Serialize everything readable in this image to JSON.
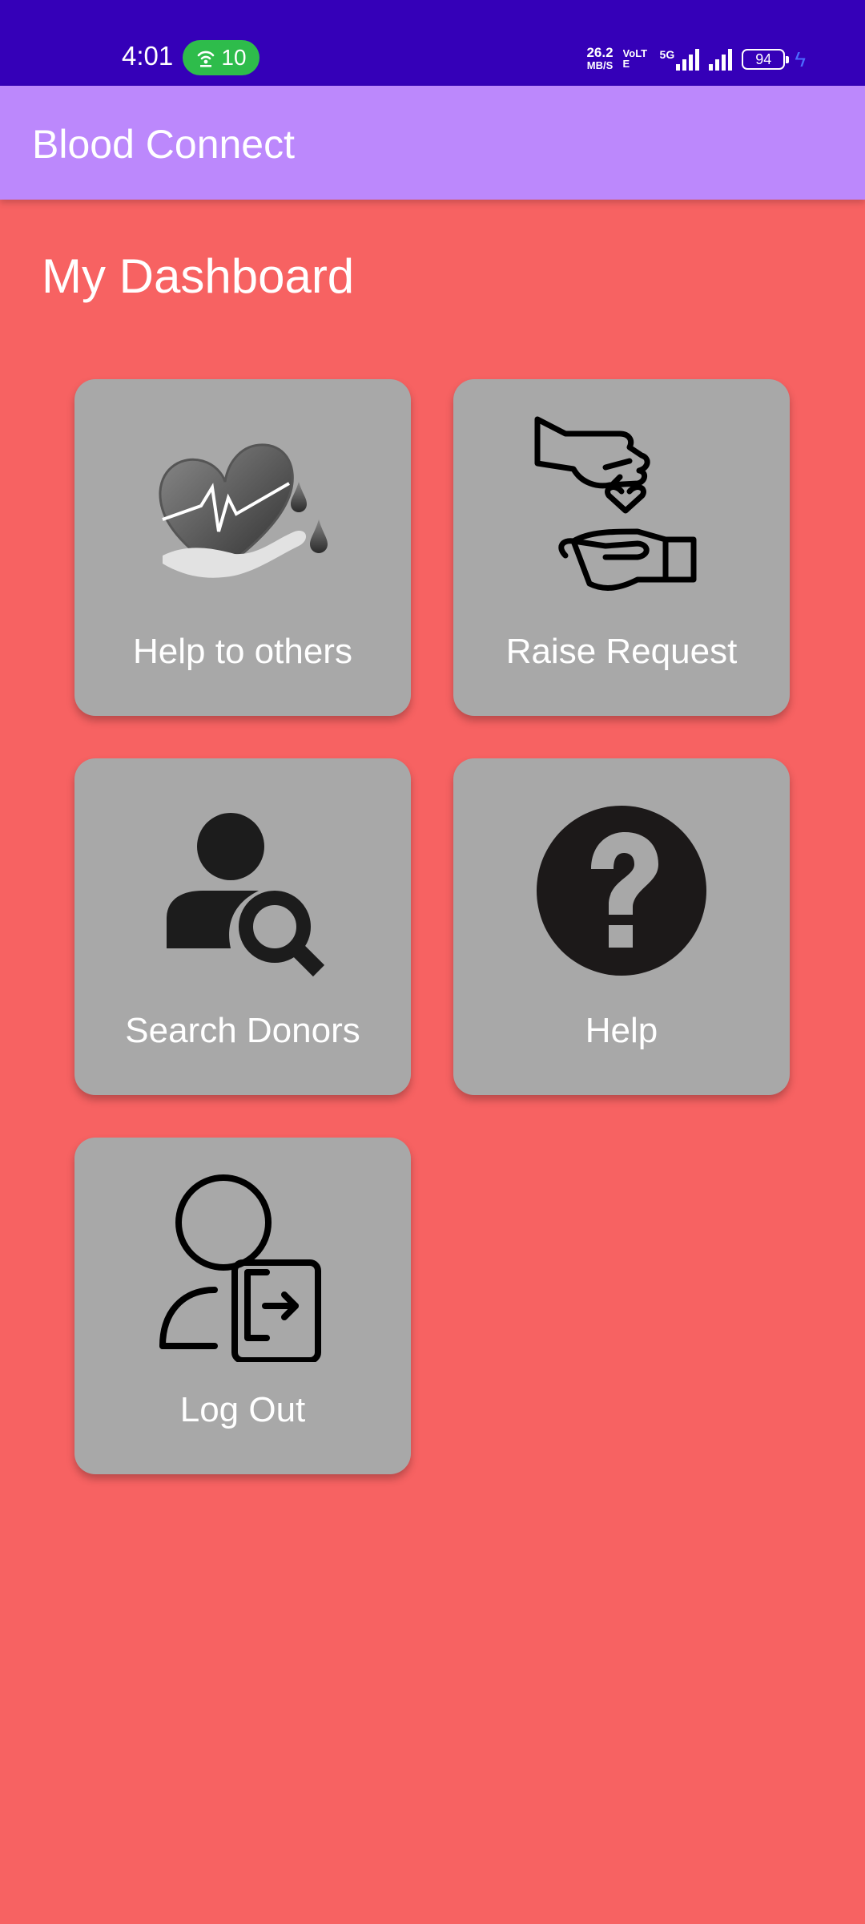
{
  "status_bar": {
    "time": "4:01",
    "hotspot_count": "10",
    "speed_value": "26.2",
    "speed_unit": "MB/S",
    "volte_top": "VoLTE",
    "network": "5G",
    "battery": "94",
    "colors": {
      "background": "#3500b8",
      "hotspot": "#2ebc4b"
    }
  },
  "app_bar": {
    "title": "Blood Connect",
    "color": "#bc88fc"
  },
  "dashboard": {
    "title": "My Dashboard",
    "background": "#f76262",
    "cards": [
      {
        "label": "Help to others",
        "icon": "heart-hand-blood-drop-icon"
      },
      {
        "label": "Raise Request",
        "icon": "hand-giving-heart-icon"
      },
      {
        "label": "Search Donors",
        "icon": "user-search-icon"
      },
      {
        "label": "Help",
        "icon": "question-circle-icon"
      },
      {
        "label": "Log Out",
        "icon": "user-logout-icon"
      }
    ]
  }
}
